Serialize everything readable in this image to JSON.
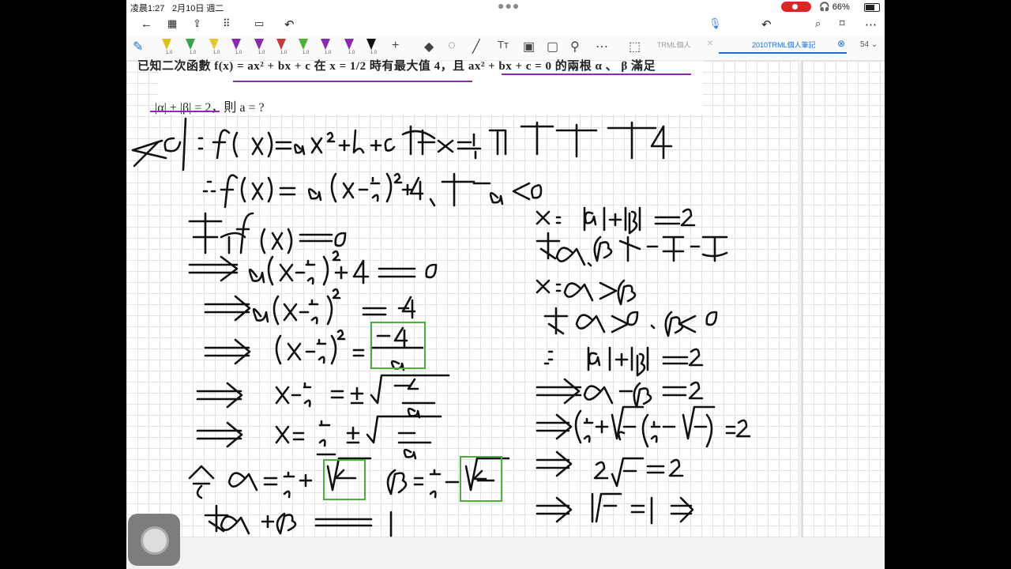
{
  "status": {
    "time": "凌晨1:27",
    "date": "2月10日 週二",
    "battery": "66%"
  },
  "tabs": {
    "tab1": "TRML個人",
    "tab2": "2010TRML個人筆記",
    "page_num": "54"
  },
  "problem": {
    "line1": "已知二次函數 f(x) = ax² + bx + c 在 x = 1/2 時有最大值 4，且 ax² + bx + c = 0 的兩根 α 、 β 滿足",
    "line2": "|α| + |β| = 2，則 a = ?"
  },
  "icons": [
    "back-icon",
    "grid-icon",
    "share-icon",
    "apps-icon",
    "tablet-icon",
    "undo-icon",
    "mic-icon",
    "redo-icon",
    "search-icon",
    "bookmark-icon",
    "more-icon"
  ],
  "colors": {
    "ink": "#111111",
    "highlight_box": "#4caf37",
    "underline": "#8a2ab0",
    "accent": "#1a6fd6"
  }
}
